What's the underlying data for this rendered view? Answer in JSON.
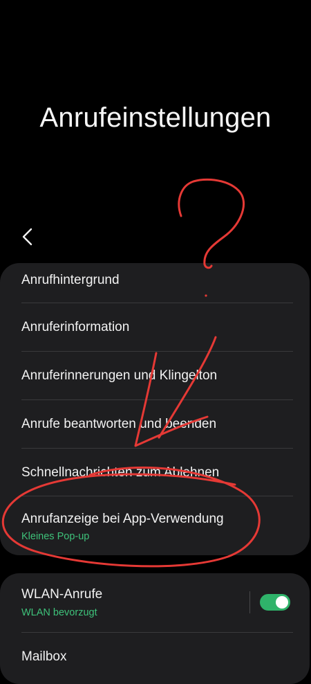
{
  "header": {
    "title": "Anrufeinstellungen",
    "back_icon": "chevron-left-icon"
  },
  "settings_group_1": {
    "items": [
      {
        "label": "Anrufhintergrund"
      },
      {
        "label": "Anruferinformation"
      },
      {
        "label": "Anruferinnerungen und Klingelton"
      },
      {
        "label": "Anrufe beantworten und beenden"
      },
      {
        "label": "Schnellnachrichten zum Ablehnen"
      },
      {
        "label": "Anrufanzeige bei App-Verwendung",
        "value": "Kleines Pop-up"
      }
    ]
  },
  "settings_group_2": {
    "items": [
      {
        "label": "WLAN-Anrufe",
        "value": "WLAN bevorzugt",
        "toggle_on": true
      },
      {
        "label": "Mailbox"
      }
    ]
  },
  "colors": {
    "background": "#000000",
    "card": "#1e1e20",
    "accent": "#3ec27a",
    "annotation_ink": "#e53935"
  }
}
